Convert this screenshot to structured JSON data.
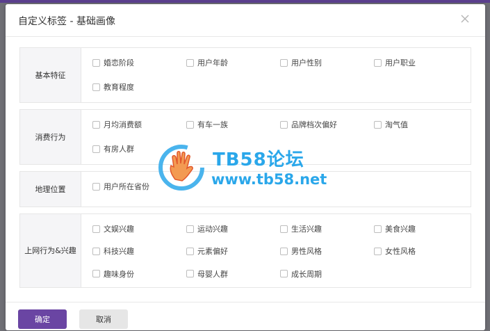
{
  "dialog": {
    "title": "自定义标签 - 基础画像"
  },
  "sections": [
    {
      "label": "基本特征",
      "options": [
        "婚恋阶段",
        "用户年龄",
        "用户性别",
        "用户职业",
        "教育程度"
      ]
    },
    {
      "label": "消费行为",
      "options": [
        "月均消费额",
        "有车一族",
        "品牌档次偏好",
        "淘气值",
        "有房人群"
      ]
    },
    {
      "label": "地理位置",
      "options": [
        "用户所在省份"
      ]
    },
    {
      "label": "上网行为&兴趣",
      "options": [
        "文娱兴趣",
        "运动兴趣",
        "生活兴趣",
        "美食兴趣",
        "科技兴趣",
        "元素偏好",
        "男性风格",
        "女性风格",
        "趣味身份",
        "母婴人群",
        "成长周期"
      ]
    }
  ],
  "watermark": {
    "line1": "TB58论坛",
    "line2": "www.tb58.net"
  },
  "footer": {
    "confirm_label": "确定",
    "cancel_label": "取消"
  },
  "colors": {
    "accent": "#6a45a3",
    "watermark": "#2aa7ea",
    "overlay": "#6f6f75"
  },
  "icons": {
    "close": "close-icon",
    "watermark_logo": "hand-logo-icon",
    "checkbox": "checkbox-unchecked-icon"
  }
}
